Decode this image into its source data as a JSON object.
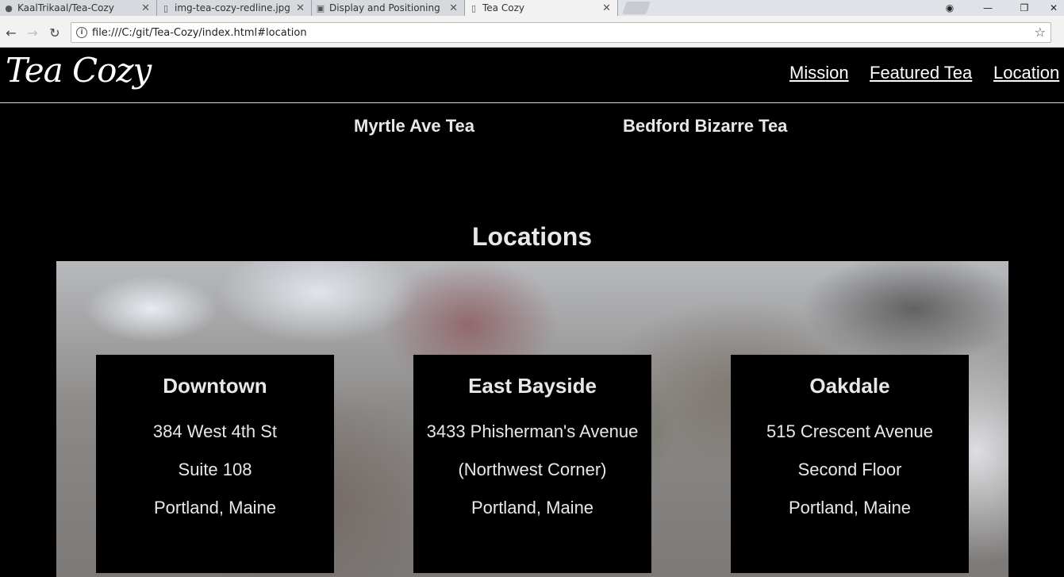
{
  "browser": {
    "tabs": [
      {
        "title": "KaalTrikaal/Tea-Cozy",
        "icon": "github-icon"
      },
      {
        "title": "img-tea-cozy-redline.jpg",
        "icon": "document-icon"
      },
      {
        "title": "Display and Positioning |",
        "icon": "codecademy-icon"
      },
      {
        "title": "Tea Cozy",
        "icon": "document-icon",
        "active": true
      }
    ],
    "url": "file:///C:/git/Tea-Cozy/index.html#location"
  },
  "header": {
    "logo": "Tea Cozy",
    "nav": [
      "Mission",
      "Featured Tea",
      "Location"
    ]
  },
  "featured": {
    "teas": [
      "Myrtle Ave Tea",
      "Bedford Bizarre Tea"
    ]
  },
  "locations": {
    "title": "Locations",
    "items": [
      {
        "name": "Downtown",
        "lines": [
          "384 West 4th St",
          "Suite 108",
          "Portland, Maine"
        ]
      },
      {
        "name": "East Bayside",
        "lines": [
          "3433 Phisherman's Avenue",
          "(Northwest Corner)",
          "Portland, Maine"
        ]
      },
      {
        "name": "Oakdale",
        "lines": [
          "515 Crescent Avenue",
          "Second Floor",
          "Portland, Maine"
        ]
      }
    ]
  },
  "colors": {
    "page_background": "#000000",
    "text": "#e8e8e8",
    "chrome": "#f2f2f2"
  }
}
